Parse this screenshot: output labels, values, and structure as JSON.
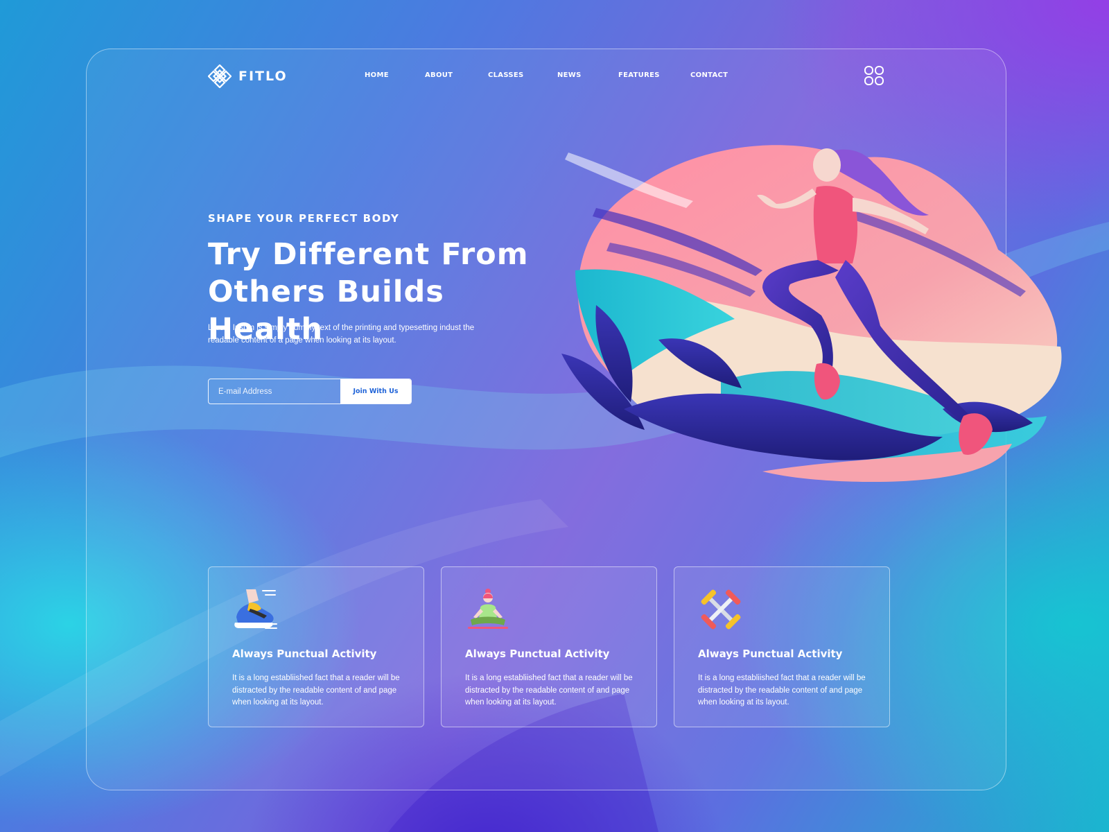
{
  "brand": {
    "name": "FITLO",
    "logo_icon": "snowflake-flower-icon"
  },
  "nav": {
    "items": [
      {
        "label": "HOME"
      },
      {
        "label": "ABOUT"
      },
      {
        "label": "CLASSES"
      },
      {
        "label": "NEWS"
      },
      {
        "label": "FEATURES"
      },
      {
        "label": "CONTACT"
      }
    ],
    "menu_icon": "grid-menu-icon"
  },
  "hero": {
    "eyebrow": "SHAPE YOUR PERFECT BODY",
    "title_line1": "Try Different From",
    "title_line2": "Others Builds Health",
    "description": "Lorem Ipsum is simply dummy text of the printing and typesetting indust the readable content of a page when looking at its layout.",
    "email_placeholder": "E-mail Address",
    "cta_label": "Join With Us",
    "illustration": "runner-woman-illustration"
  },
  "features": [
    {
      "icon": "running-shoe-icon",
      "title": "Always Punctual Activity",
      "text": "It is a long establiished fact that a reader will be distracted by the readable content of and page when looking at its layout."
    },
    {
      "icon": "meditation-icon",
      "title": "Always Punctual Activity",
      "text": "It is a long establiished fact that a reader will be distracted by the readable content of and page when looking at its layout."
    },
    {
      "icon": "dumbbells-icon",
      "title": "Always Punctual Activity",
      "text": "It is a long establiished fact that a reader will be distracted by the readable content of and page when looking at its layout."
    }
  ],
  "colors": {
    "cta_text": "#1f63d8",
    "runner_pink": "#f06a8c",
    "leaf_navy": "#2b2a9e",
    "leaf_teal": "#20c4d4"
  }
}
